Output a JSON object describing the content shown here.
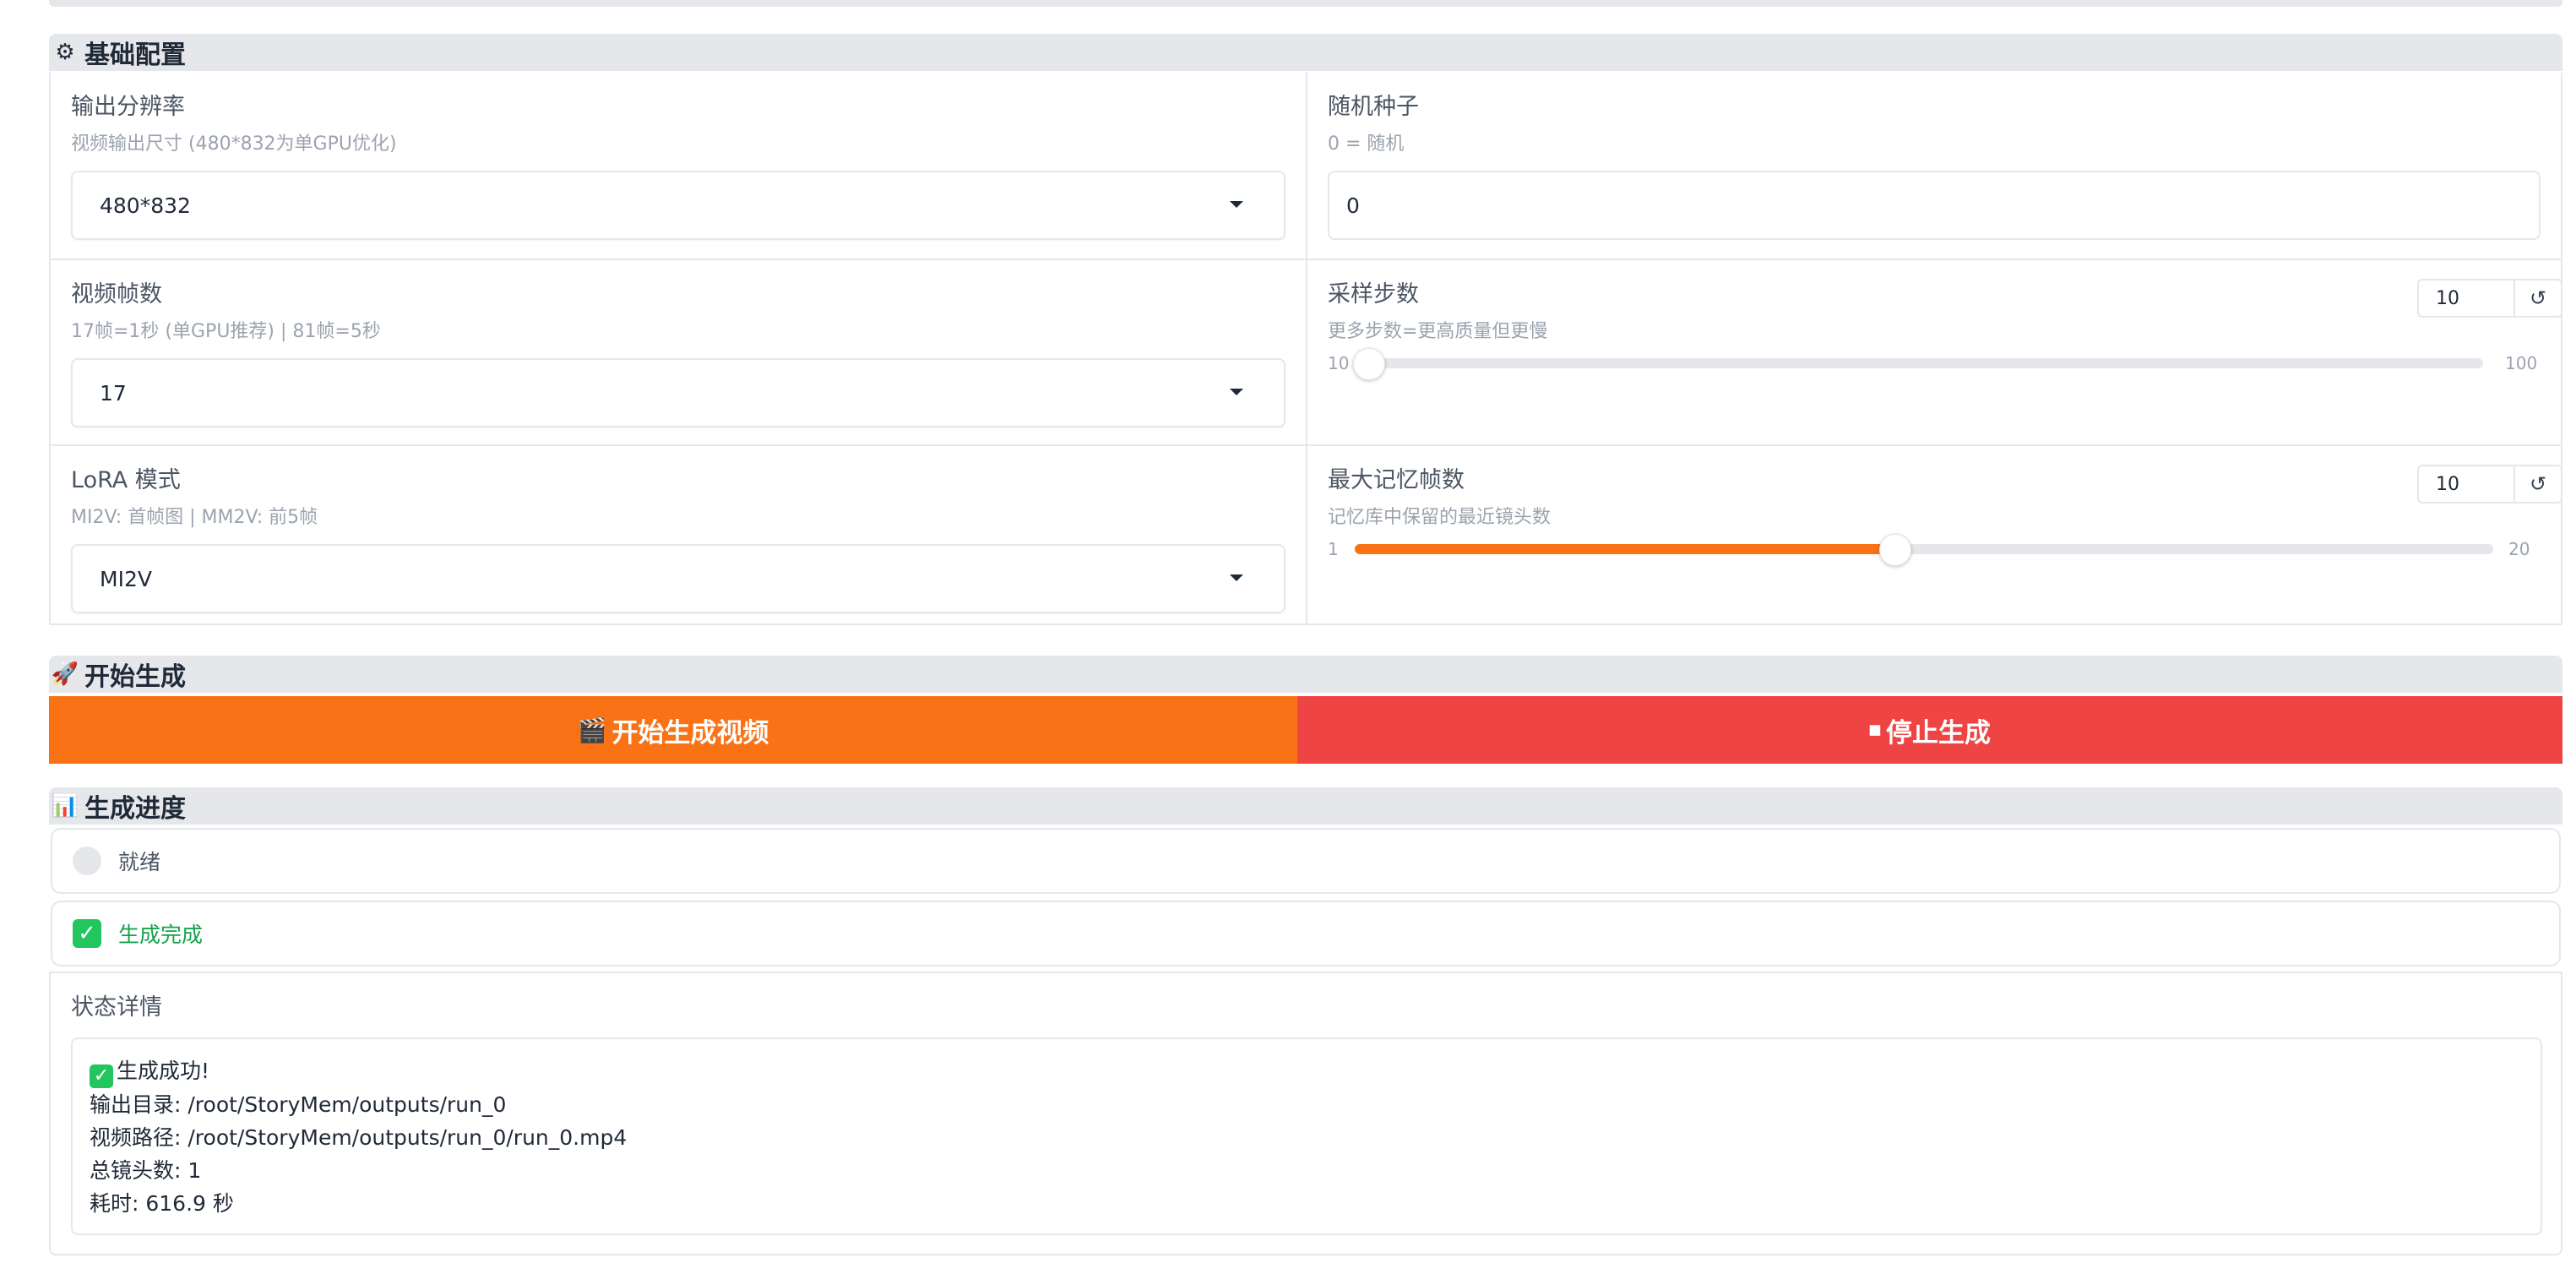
{
  "sections": {
    "config": {
      "icon": "gear-icon",
      "title": "基础配置"
    },
    "generate": {
      "icon": "rocket-icon",
      "title": "开始生成"
    },
    "progress": {
      "icon": "bar-chart-icon",
      "title": "生成进度"
    }
  },
  "config": {
    "resolution": {
      "label": "输出分辨率",
      "info": "视频输出尺寸 (480*832为单GPU优化)",
      "value": "480*832"
    },
    "seed": {
      "label": "随机种子",
      "info": "0 = 随机",
      "value": "0"
    },
    "frames": {
      "label": "视频帧数",
      "info": "17帧=1秒 (单GPU推荐) | 81帧=5秒",
      "value": "17"
    },
    "steps": {
      "label": "采样步数",
      "info": "更多步数=更高质量但更慢",
      "value": "10",
      "min": "10",
      "max": "100",
      "fraction": 0.0
    },
    "lora": {
      "label": "LoRA 模式",
      "info": "MI2V: 首帧图 | MM2V: 前5帧",
      "value": "MI2V"
    },
    "memory": {
      "label": "最大记忆帧数",
      "info": "记忆库中保留的最近镜头数",
      "value": "10",
      "min": "1",
      "max": "20",
      "fraction": 0.4737
    }
  },
  "buttons": {
    "start": {
      "icon": "clapper-icon",
      "label": "开始生成视频",
      "color": "#f97316"
    },
    "stop": {
      "icon": "stop-icon",
      "label": "停止生成",
      "color": "#ef4444"
    }
  },
  "status": {
    "ready": "就绪",
    "done": "生成完成",
    "done_color": "#16a34a",
    "details_label": "状态详情",
    "details": {
      "line1": "生成成功!",
      "line2": "输出目录: /root/StoryMem/outputs/run_0",
      "line3": "视频路径: /root/StoryMem/outputs/run_0/run_0.mp4",
      "line4": "总镜头数: 1",
      "line5": "耗时: 616.9 秒"
    }
  }
}
